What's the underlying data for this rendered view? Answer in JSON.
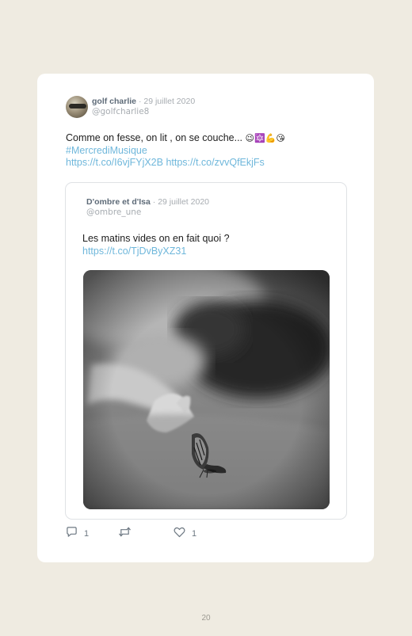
{
  "tweet": {
    "author_name": "golf charlie",
    "separator": "·",
    "date": "29 juillet 2020",
    "handle": "@golfcharlie8",
    "text": "Comme on fesse, on lit , on se couche...",
    "emojis": "😉🔯💪😘",
    "hashtag": "#MercrediMusique",
    "link1": "https://t.co/I6vjFYjX2B",
    "link2": "https://t.co/zvvQfEkjFs"
  },
  "quoted": {
    "author_name": "D'ombre et d'Isa",
    "separator": "·",
    "date": "29 juillet 2020",
    "handle": "@ombre_une",
    "text": "Les matins vides on en fait quoi ?",
    "link": "https://t.co/TjDvByXZ31",
    "image_alt": "black and white photo of a woman lying with outstretched hand near a butterfly"
  },
  "actions": {
    "reply_count": "1",
    "retweet_count": "",
    "like_count": "1"
  },
  "page_number": "20",
  "colors": {
    "background": "#efebe1",
    "card": "#ffffff",
    "link": "#6fb7db",
    "muted": "#a7acb1"
  }
}
